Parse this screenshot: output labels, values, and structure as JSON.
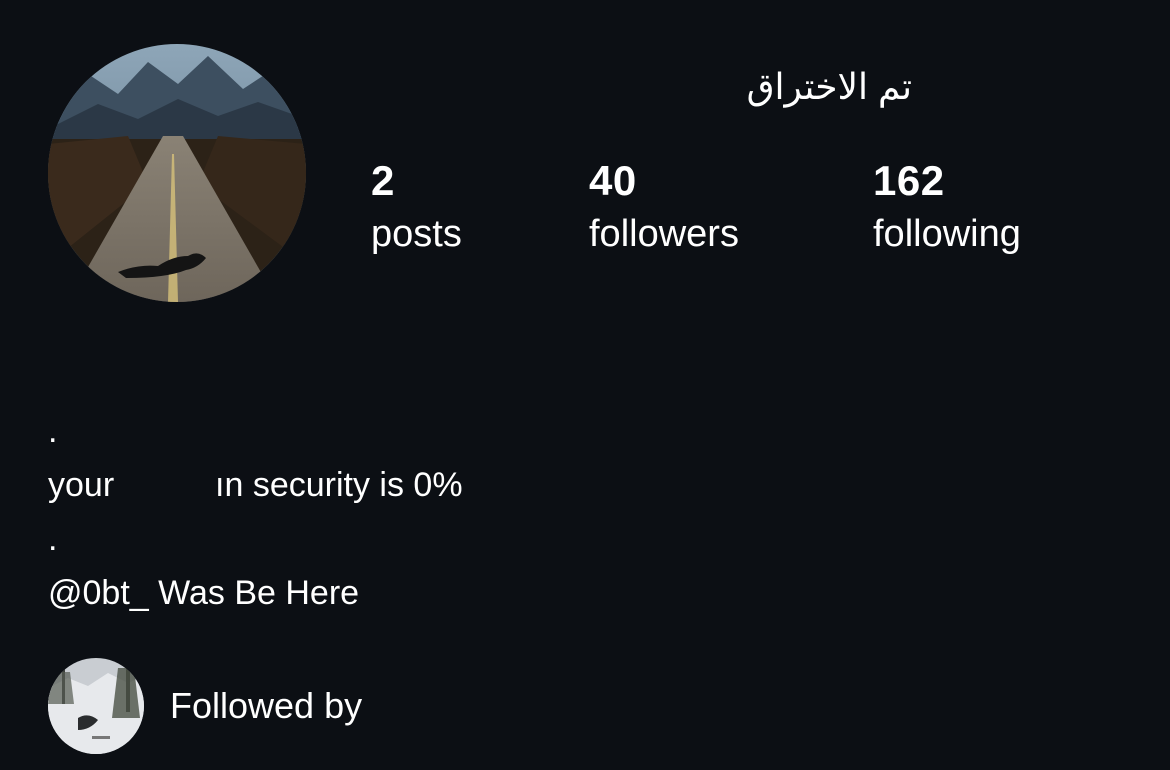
{
  "profile": {
    "display_name": "تم الاختراق",
    "stats": {
      "posts": {
        "count": "2",
        "label": "posts"
      },
      "followers": {
        "count": "40",
        "label": "followers"
      },
      "following": {
        "count": "162",
        "label": "following"
      }
    },
    "bio": {
      "dot_1": ".",
      "line_1_start": "your",
      "line_1_end": "ın security is 0%",
      "dot_2": ".",
      "line_2": "@0bt_ Was Be Here"
    },
    "followed_by": {
      "label": "Followed by"
    }
  },
  "colors": {
    "background": "#0c0f14",
    "text": "#ffffff"
  }
}
